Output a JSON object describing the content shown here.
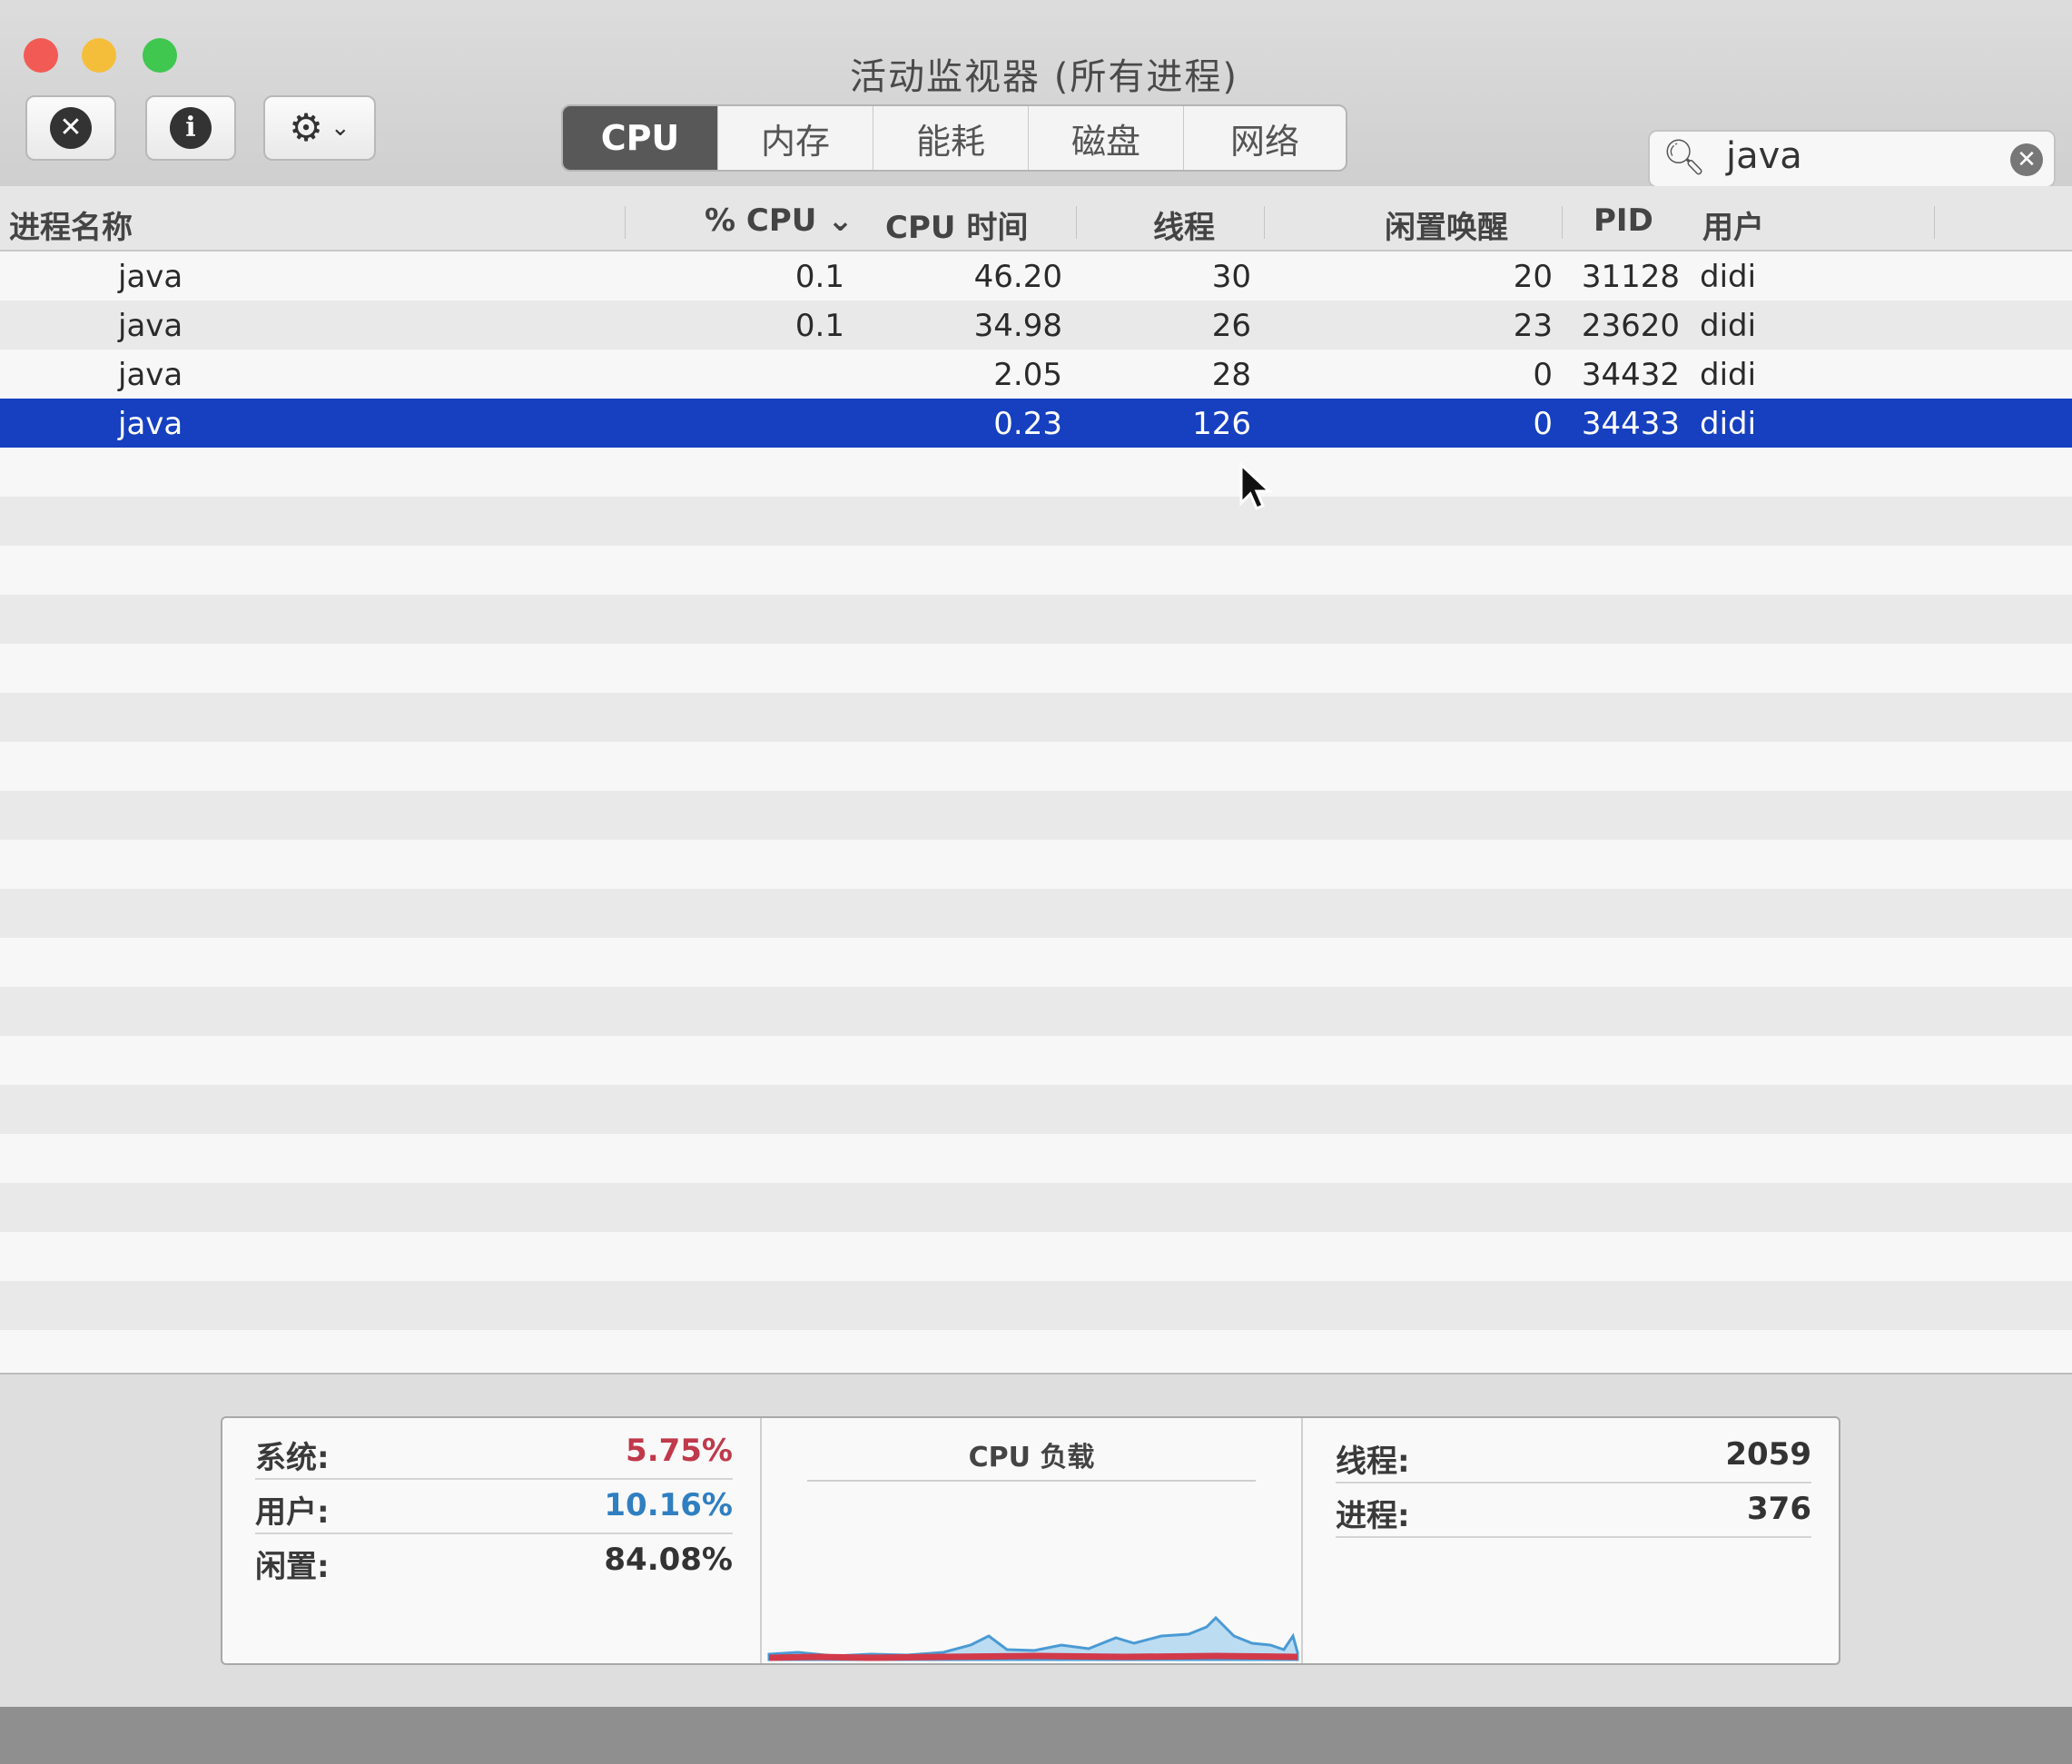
{
  "window": {
    "title": "活动监视器 (所有进程)"
  },
  "toolbar": {
    "stop_glyph": "✕",
    "info_glyph": "i",
    "gear_glyph": "⚙",
    "chevron_glyph": "⌄"
  },
  "tabs": [
    {
      "label": "CPU",
      "active": true
    },
    {
      "label": "内存",
      "active": false
    },
    {
      "label": "能耗",
      "active": false
    },
    {
      "label": "磁盘",
      "active": false
    },
    {
      "label": "网络",
      "active": false
    }
  ],
  "search": {
    "icon_glyph": "🔍︎",
    "value": "java",
    "clear_glyph": "✕"
  },
  "table": {
    "columns": {
      "name": "进程名称",
      "cpu": "% CPU ⌄",
      "cpu_time": "CPU 时间",
      "threads": "线程",
      "idle_wakeups": "闲置唤醒",
      "pid": "PID",
      "user": "用户"
    },
    "rows": [
      {
        "name": "java",
        "cpu": "0.1",
        "cpu_time": "46.20",
        "threads": "30",
        "idle_wakeups": "20",
        "pid": "31128",
        "user": "didi",
        "selected": false
      },
      {
        "name": "java",
        "cpu": "0.1",
        "cpu_time": "34.98",
        "threads": "26",
        "idle_wakeups": "23",
        "pid": "23620",
        "user": "didi",
        "selected": false
      },
      {
        "name": "java",
        "cpu": "",
        "cpu_time": "2.05",
        "threads": "28",
        "idle_wakeups": "0",
        "pid": "34432",
        "user": "didi",
        "selected": false
      },
      {
        "name": "java",
        "cpu": "",
        "cpu_time": "0.23",
        "threads": "126",
        "idle_wakeups": "0",
        "pid": "34433",
        "user": "didi",
        "selected": true
      }
    ]
  },
  "stats": {
    "system": {
      "label": "系统:",
      "value": "5.75%",
      "color": "#c0394b"
    },
    "user": {
      "label": "用户:",
      "value": "10.16%",
      "color": "#2f7fc1"
    },
    "idle": {
      "label": "闲置:",
      "value": "84.08%",
      "color": "#333333"
    },
    "chart_title": "CPU 负载",
    "threads": {
      "label": "线程:",
      "value": "2059"
    },
    "processes": {
      "label": "进程:",
      "value": "376"
    }
  },
  "colors": {
    "selection": "#1640c0",
    "system_line": "#d23a4a",
    "user_line": "#4a9ad4"
  }
}
